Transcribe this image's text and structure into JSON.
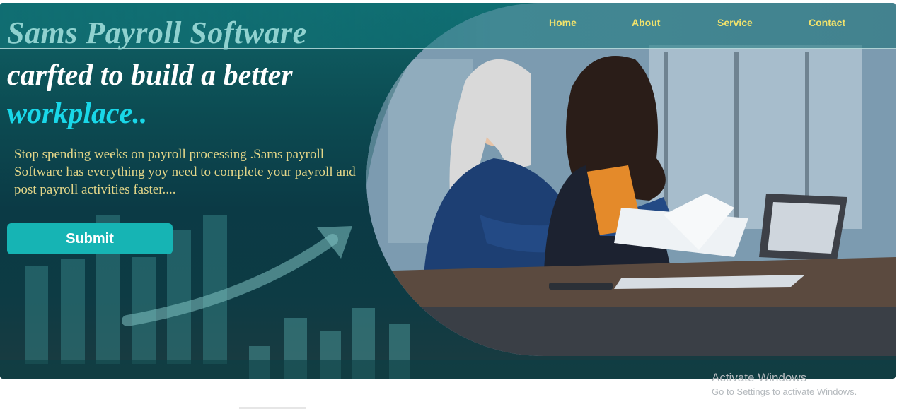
{
  "nav": {
    "home": "Home",
    "about": "About",
    "service": "Service",
    "contact": "Contact"
  },
  "hero": {
    "brand": "Sams Payroll Software",
    "headline": "carfted to build a better",
    "headline_accent": "workplace..",
    "description": "Stop spending weeks on payroll processing .Sams payroll Software has everything yoy need to complete your payroll and post payroll activities faster....",
    "submit_label": "Submit",
    "photo_alt": "Two colleagues reviewing documents at a desk with a laptop"
  },
  "watermark": {
    "title": "Activate Windows",
    "subtitle": "Go to Settings to activate Windows."
  },
  "colors": {
    "nav_text": "#f1e26b",
    "brand_text": "#8fd1cf",
    "accent": "#19d7e8",
    "description_text": "#e2d588",
    "button_bg": "#16b4b4",
    "hero_bg": "#0b3a45"
  },
  "icons": [
    "growth-arrow-icon"
  ]
}
